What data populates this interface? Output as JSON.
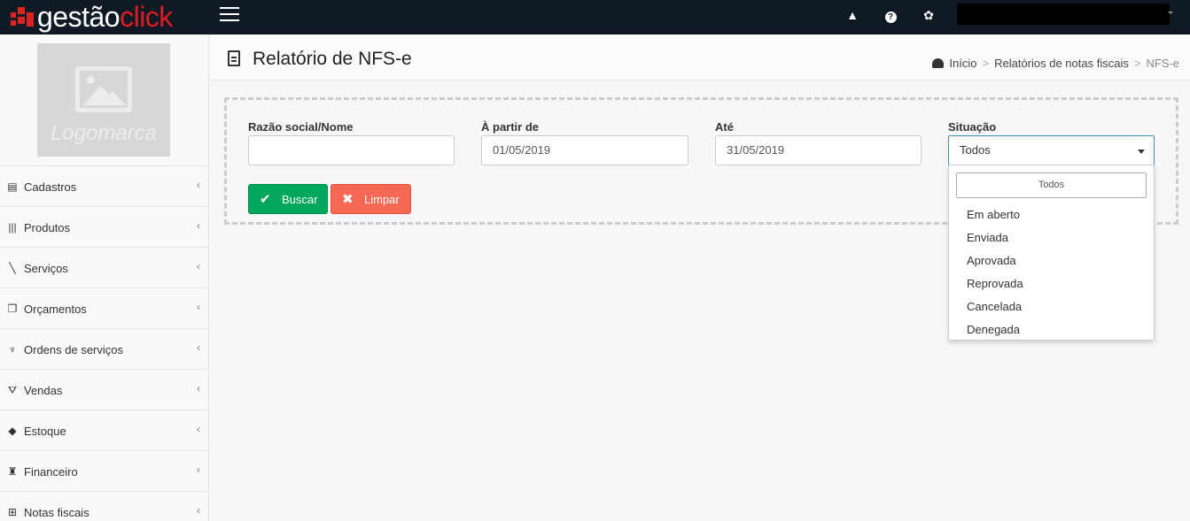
{
  "brand": {
    "part1": "gestão",
    "part2": "click",
    "accent": "#e11b22",
    "topbar_color": "#0f1a24"
  },
  "topbar": {
    "icons": [
      "warning-icon",
      "help-icon",
      "gears-icon"
    ]
  },
  "sidebar": {
    "logo_label": "Logomarca",
    "items": [
      {
        "label": "Cadastros",
        "icon": "list-card-icon"
      },
      {
        "label": "Produtos",
        "icon": "barcode-icon"
      },
      {
        "label": "Serviços",
        "icon": "screwdriver-icon"
      },
      {
        "label": "Orçamentos",
        "icon": "documents-icon"
      },
      {
        "label": "Ordens de serviços",
        "icon": "trophy-icon"
      },
      {
        "label": "Vendas",
        "icon": "basket-icon"
      },
      {
        "label": "Estoque",
        "icon": "cube-icon"
      },
      {
        "label": "Financeiro",
        "icon": "money-bag-icon"
      },
      {
        "label": "Notas fiscais",
        "icon": "sitemap-icon"
      }
    ]
  },
  "header": {
    "title": "Relatório de NFS-e",
    "breadcrumb": [
      "Início",
      "Relatórios de notas fiscais",
      "NFS-e"
    ]
  },
  "filters": {
    "razao_label": "Razão social/Nome",
    "razao_value": "",
    "inicio_label": "À partir de",
    "inicio_value": "01/05/2019",
    "ate_label": "Até",
    "ate_value": "31/05/2019",
    "situacao_label": "Situação",
    "situacao_value": "Todos"
  },
  "buttons": {
    "buscar": "Buscar",
    "limpar": "Limpar"
  },
  "dropdown": {
    "search_value": "Todos",
    "options": [
      "Em aberto",
      "Enviada",
      "Aprovada",
      "Reprovada",
      "Cancelada",
      "Denegada"
    ]
  }
}
